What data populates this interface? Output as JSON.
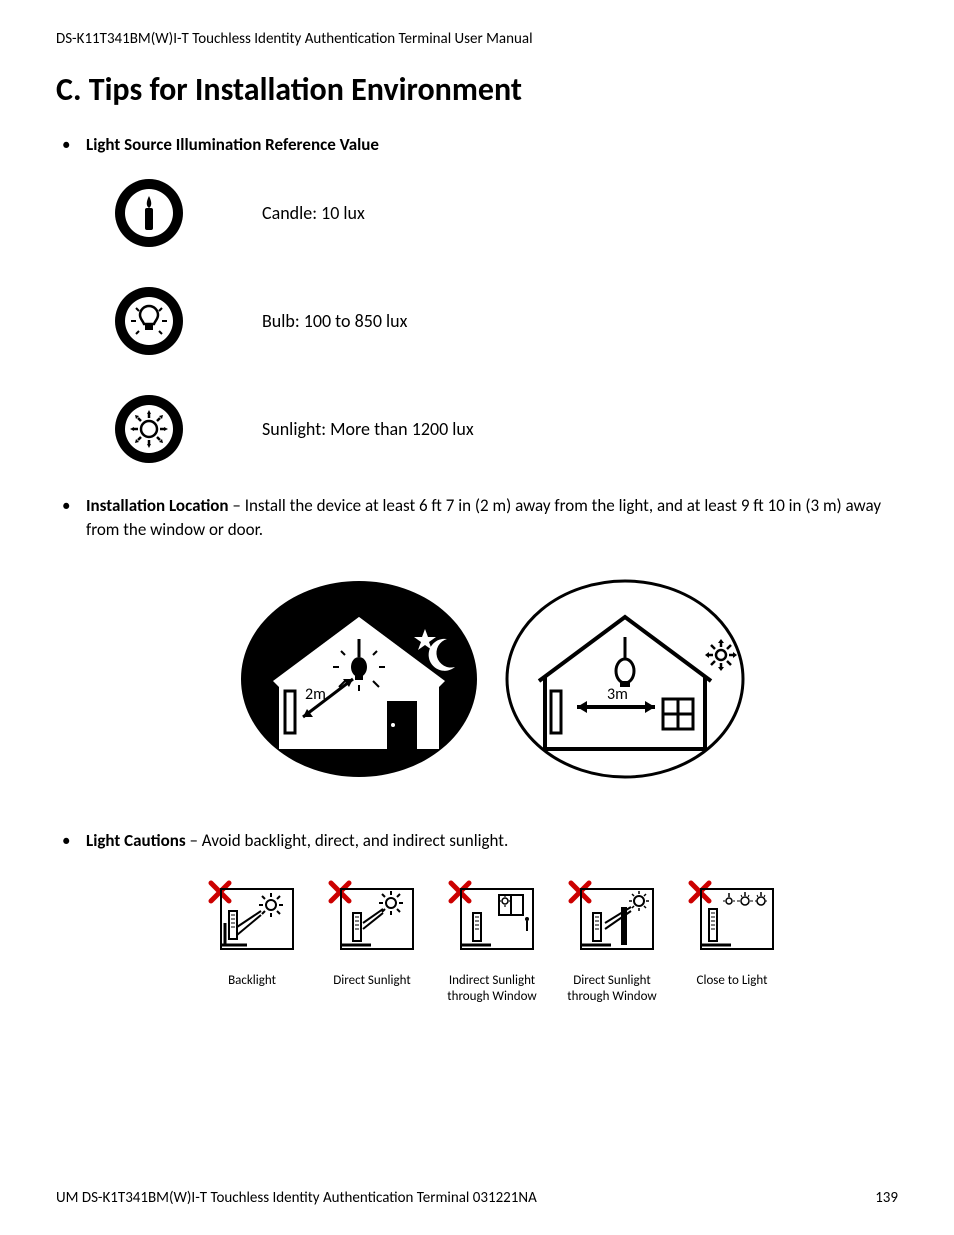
{
  "header": {
    "running_title": "DS-K11T341BM(W)I-T Touchless Identity Authentication Terminal User Manual"
  },
  "title": "C. Tips for Installation Environment",
  "bullets": {
    "b1_label": "Light Source Illumination Reference Value",
    "b2_label": "Installation Location",
    "b2_rest": " – Install the device at least 6 ft 7 in (2 m) away from the light, and at least 9 ft 10 in (3 m) away from the window or door.",
    "b3_label": "Light Cautions",
    "b3_rest": " – Avoid backlight, direct, and indirect sunlight."
  },
  "lux": {
    "candle": "Candle: 10 lux",
    "bulb": "Bulb: 100 to 850 lux",
    "sunlight": "Sunlight: More than 1200 lux"
  },
  "loc_fig": {
    "left_dist": "2m",
    "right_dist": "3m"
  },
  "cautions": [
    {
      "caption": "Backlight"
    },
    {
      "caption": "Direct Sunlight"
    },
    {
      "caption": "Indirect Sunlight through Window"
    },
    {
      "caption": "Direct Sunlight through Window"
    },
    {
      "caption": "Close to Light"
    }
  ],
  "footer": {
    "left": "UM DS-K1T341BM(W)I-T Touchless Identity Authentication Terminal 031221NA",
    "page_no": "139"
  }
}
